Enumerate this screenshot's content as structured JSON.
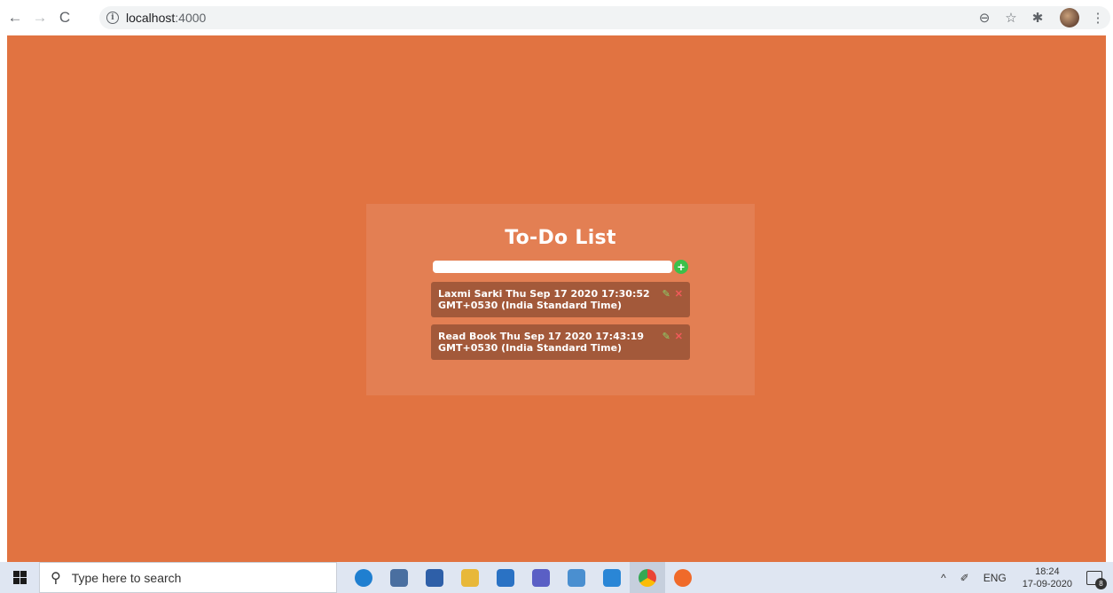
{
  "browser": {
    "back_icon": "←",
    "forward_icon": "→",
    "reload_icon": "C",
    "info_icon": "i",
    "url_host": "localhost",
    "url_port": ":4000",
    "zoom_icon": "⊖",
    "star_icon": "☆",
    "extensions_icon": "✱",
    "menu_icon": "⋮"
  },
  "app": {
    "title": "To-Do List",
    "input_value": "",
    "add_label": "+",
    "todos": [
      {
        "text": "Laxmi Sarki Thu Sep 17 2020 17:30:52 GMT+0530 (India Standard Time)",
        "edit_icon": "✎",
        "delete_icon": "✕"
      },
      {
        "text": "Read Book Thu Sep 17 2020 17:43:19 GMT+0530 (India Standard Time)",
        "edit_icon": "✎",
        "delete_icon": "✕"
      }
    ],
    "colors": {
      "background": "#e17341",
      "card": "#e37f53",
      "item": "#a3593a",
      "add_button": "#3cc04a",
      "edit": "#8bd46a",
      "delete": "#f05a5a"
    }
  },
  "taskbar": {
    "search_placeholder": "Type here to search",
    "tray_chevron": "^",
    "tray_pen": "✐",
    "language": "ENG",
    "time": "18:24",
    "date": "17-09-2020",
    "notification_count": "8",
    "apps": [
      "edge-icon",
      "mysql-workbench-icon",
      "store-icon",
      "file-explorer-icon",
      "mail-icon",
      "teams-icon",
      "notepad-icon",
      "vscode-icon",
      "chrome-icon",
      "app-icon"
    ]
  }
}
